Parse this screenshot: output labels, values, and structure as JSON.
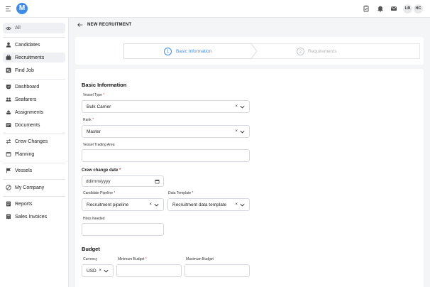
{
  "app": {
    "logo_letter": "M"
  },
  "header": {
    "icons": [
      "clipboard-icon",
      "bell-icon",
      "mail-icon"
    ],
    "avatars": [
      "LB",
      "HC"
    ]
  },
  "sidebar": {
    "all_label": "All",
    "items": [
      {
        "label": "Candidates",
        "icon": "person-icon"
      },
      {
        "label": "Recruitments",
        "icon": "briefcase-icon",
        "active": true
      },
      {
        "label": "Find Job",
        "icon": "search-icon"
      },
      {
        "label": "Dashboard",
        "icon": "dashboard-icon"
      },
      {
        "label": "Seafarers",
        "icon": "users-icon"
      },
      {
        "label": "Assignments",
        "icon": "ship-icon"
      },
      {
        "label": "Documents",
        "icon": "document-icon"
      },
      {
        "label": "Crew Changes",
        "icon": "swap-icon"
      },
      {
        "label": "Planning",
        "icon": "calendar-icon"
      },
      {
        "label": "Vessels",
        "icon": "flag-icon"
      },
      {
        "label": "My Company",
        "icon": "building-icon"
      },
      {
        "label": "Reports",
        "icon": "report-icon"
      },
      {
        "label": "Sales Invoices",
        "icon": "invoice-icon"
      }
    ]
  },
  "page": {
    "title": "NEW RECRUITMENT"
  },
  "stepper": {
    "steps": [
      {
        "number": "1",
        "label": "Basic Information",
        "active": true
      },
      {
        "number": "2",
        "label": "Requirements",
        "active": false
      }
    ]
  },
  "form": {
    "basic_title": "Basic Information",
    "vessel_type": {
      "label": "Vessel Type",
      "value": "Bulk Carrier"
    },
    "rank": {
      "label": "Rank",
      "value": "Master"
    },
    "trading_area": {
      "label": "Vessel Trading Area",
      "value": ""
    },
    "crew_change_date": {
      "label": "Crew change date",
      "placeholder": "dd/mm/yyyy"
    },
    "pipeline": {
      "label": "Candidate Pipeline",
      "value": "Recruitment pipeline"
    },
    "data_template": {
      "label": "Data Template",
      "value": "Recruitment data template"
    },
    "hires_needed": {
      "label": "Hires Needed",
      "value": ""
    },
    "budget_title": "Budget",
    "currency": {
      "label": "Currency",
      "value": "USD"
    },
    "min_budget": {
      "label": "Minimum Budget"
    },
    "max_budget": {
      "label": "Maximum Budget"
    },
    "required_mark": "*",
    "clear_symbol": "×"
  },
  "colors": {
    "accent": "#3f8ce8",
    "required": "#e23b3b",
    "active_nav_bg": "#eef0f3"
  }
}
